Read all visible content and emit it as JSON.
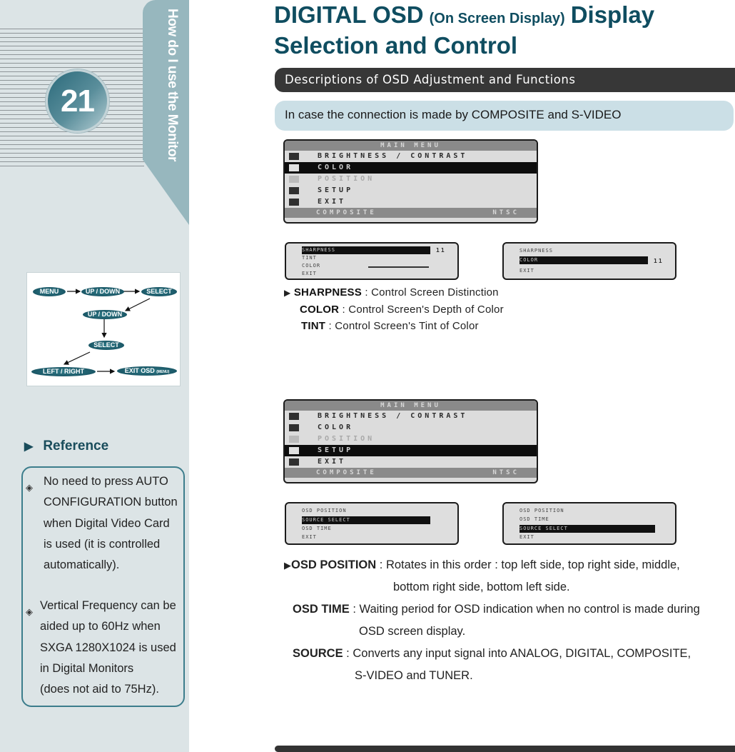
{
  "sidebar": {
    "tab_label": "How do I use the Monitor",
    "page_number": "21",
    "flow": {
      "menu": "MENU",
      "up_down_1": "UP / DOWN",
      "select_1": "SELECT",
      "up_down_2": "UP / DOWN",
      "select_2": "SELECT",
      "left_right": "LEFT / RIGHT",
      "exit_osd": "EXIT OSD",
      "exit_osd_note": "(MENU)"
    },
    "reference": {
      "heading": "Reference",
      "items": [
        "No need to press AUTO CONFIGURATION button when Digital Video Card is used (it is controlled automatically).",
        "Vertical Frequency can be aided up to 60Hz  when SXGA 1280X1024 is used in Digital Monitors (does not aid to 75Hz)."
      ],
      "item_lines": [
        [
          "No need to press AUTO",
          "CONFIGURATION button",
          "when Digital Video Card",
          "is used (it is controlled",
          "automatically)."
        ],
        [
          "Vertical Frequency can be",
          "aided up to 60Hz  when",
          "SXGA 1280X1024 is used",
          "in Digital Monitors",
          "(does not aid to 75Hz)."
        ]
      ]
    }
  },
  "main": {
    "title_part1": "DIGITAL OSD",
    "title_paren": "(On Screen Display)",
    "title_part2": "Display",
    "title_line2": "Selection and Control",
    "section_header": "Descriptions of OSD Adjustment and Functions",
    "info_bar": "In case the connection is made by COMPOSITE and S-VIDEO",
    "osd_menu_1": {
      "header": "MAIN MENU",
      "items": [
        "BRIGHTNESS / CONTRAST",
        "COLOR",
        "POSITION",
        "SETUP",
        "EXIT"
      ],
      "selected": "COLOR",
      "footer_left": "COMPOSITE",
      "footer_right": "NTSC"
    },
    "osd_sub_1a": {
      "rows": [
        "SHARPNESS",
        "TINT",
        "COLOR",
        "EXIT"
      ],
      "selected": "SHARPNESS",
      "value": "11"
    },
    "osd_sub_1b": {
      "rows": [
        "SHARPNESS",
        "COLOR",
        "EXIT"
      ],
      "selected": "COLOR",
      "value": "11"
    },
    "desc_1": [
      {
        "term": "SHARPNESS",
        "sep": " : ",
        "text": "Control Screen Distinction"
      },
      {
        "term": "COLOR",
        "sep": " : ",
        "text": "Control Screen's Depth of Color"
      },
      {
        "term": "TINT",
        "sep": " :  ",
        "text": "Control Screen's Tint of Color"
      }
    ],
    "osd_menu_2": {
      "header": "MAIN MENU",
      "items": [
        "BRIGHTNESS / CONTRAST",
        "COLOR",
        "POSITION",
        "SETUP",
        "EXIT"
      ],
      "selected": "SETUP",
      "footer_left": "COMPOSITE",
      "footer_right": "NTSC"
    },
    "osd_sub_2a": {
      "rows": [
        "OSD POSITION",
        "SOURCE SELECT",
        "OSD TIME",
        "EXIT"
      ],
      "selected": "SOURCE SELECT"
    },
    "osd_sub_2b": {
      "rows": [
        "OSD POSITION",
        "OSD TIME",
        "SOURCE SELECT",
        "EXIT"
      ],
      "selected": "SOURCE SELECT"
    },
    "desc_2": [
      {
        "term": "OSD POSITION",
        "sep": " : ",
        "lines": [
          "Rotates  in this order : top left side, top right side, middle,",
          "bottom right side, bottom left side."
        ]
      },
      {
        "term": "OSD TIME",
        "sep": " : ",
        "lines": [
          "Waiting period for OSD indication when no control is made during",
          "OSD screen display."
        ]
      },
      {
        "term": "SOURCE",
        "sep": " : ",
        "lines": [
          "Converts any input signal into ANALOG, DIGITAL, COMPOSITE,",
          "S-VIDEO and TUNER."
        ]
      }
    ]
  },
  "colors": {
    "title": "#0f4d60",
    "sidebar_bg": "#dce4e6",
    "tab": "#97b7be",
    "section_bar": "#373737",
    "info_bar": "#cbdfe6",
    "pill": "#1b5867"
  }
}
